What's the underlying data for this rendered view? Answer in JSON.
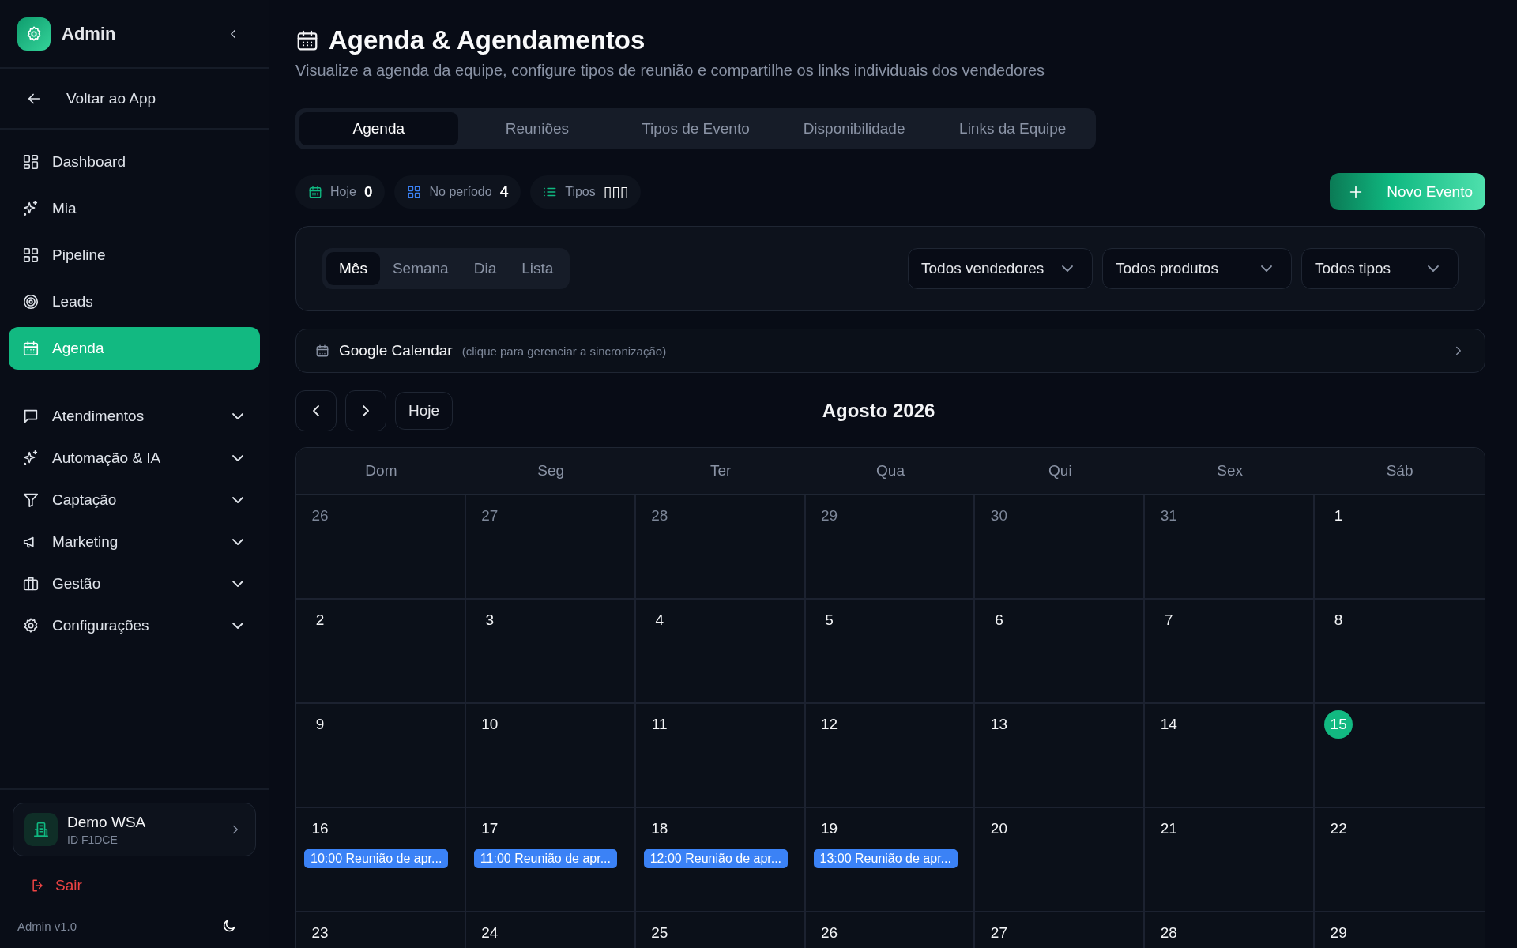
{
  "sidebar": {
    "brand": "Admin",
    "back": "Voltar ao App",
    "items": [
      {
        "label": "Dashboard",
        "selected": false
      },
      {
        "label": "Mia",
        "selected": false
      },
      {
        "label": "Pipeline",
        "selected": false
      },
      {
        "label": "Leads",
        "selected": false
      },
      {
        "label": "Agenda",
        "selected": true
      }
    ],
    "groups": [
      {
        "label": "Atendimentos",
        "expanded": false
      },
      {
        "label": "Automação & IA",
        "expanded": false
      },
      {
        "label": "Captação",
        "expanded": false
      },
      {
        "label": "Marketing",
        "expanded": false
      },
      {
        "label": "Gestão",
        "expanded": false
      },
      {
        "label": "Configurações",
        "expanded": false
      }
    ],
    "workspace": {
      "name": "Demo WSA",
      "id": "ID F1DCE"
    },
    "logout": "Sair",
    "version": "Admin v1.0"
  },
  "header": {
    "title": "Agenda & Agendamentos",
    "subtitle": "Visualize a agenda da equipe, configure tipos de reunião e compartilhe os links individuais dos vendedores"
  },
  "tabs": [
    {
      "label": "Agenda",
      "selected": true
    },
    {
      "label": "Reuniões",
      "selected": false
    },
    {
      "label": "Tipos de Evento",
      "selected": false
    },
    {
      "label": "Disponibilidade",
      "selected": false
    },
    {
      "label": "Links da Equipe",
      "selected": false
    }
  ],
  "stats": [
    {
      "label": "Hoje",
      "value": "0"
    },
    {
      "label": "No período",
      "value": "4"
    },
    {
      "label": "Tipos",
      "value": "▯▯▯"
    }
  ],
  "new_event_button": "Novo Evento",
  "view_modes": [
    {
      "label": "Mês",
      "selected": true
    },
    {
      "label": "Semana",
      "selected": false
    },
    {
      "label": "Dia",
      "selected": false
    },
    {
      "label": "Lista",
      "selected": false
    }
  ],
  "filters": [
    "Todos vendedores",
    "Todos produtos",
    "Todos tipos"
  ],
  "calendar_sync": {
    "title": "Google Calendar",
    "hint": "(clique para gerenciar a sincronização)"
  },
  "calendar": {
    "today_button": "Hoje",
    "month": "Agosto 2026",
    "weekdays": [
      "Dom",
      "Seg",
      "Ter",
      "Qua",
      "Qui",
      "Sex",
      "Sáb"
    ],
    "days": [
      {
        "day": "26",
        "muted": true,
        "today": false
      },
      {
        "day": "27",
        "muted": true,
        "today": false
      },
      {
        "day": "28",
        "muted": true,
        "today": false
      },
      {
        "day": "29",
        "muted": true,
        "today": false
      },
      {
        "day": "30",
        "muted": true,
        "today": false
      },
      {
        "day": "31",
        "muted": true,
        "today": false
      },
      {
        "day": "1",
        "muted": false,
        "today": false
      },
      {
        "day": "2",
        "muted": false,
        "today": false
      },
      {
        "day": "3",
        "muted": false,
        "today": false
      },
      {
        "day": "4",
        "muted": false,
        "today": false
      },
      {
        "day": "5",
        "muted": false,
        "today": false
      },
      {
        "day": "6",
        "muted": false,
        "today": false
      },
      {
        "day": "7",
        "muted": false,
        "today": false
      },
      {
        "day": "8",
        "muted": false,
        "today": false
      },
      {
        "day": "9",
        "muted": false,
        "today": false
      },
      {
        "day": "10",
        "muted": false,
        "today": false
      },
      {
        "day": "11",
        "muted": false,
        "today": false
      },
      {
        "day": "12",
        "muted": false,
        "today": false
      },
      {
        "day": "13",
        "muted": false,
        "today": false
      },
      {
        "day": "14",
        "muted": false,
        "today": false
      },
      {
        "day": "15",
        "muted": false,
        "today": true
      },
      {
        "day": "16",
        "muted": false,
        "today": false,
        "events": [
          "10:00 Reunião de apr..."
        ]
      },
      {
        "day": "17",
        "muted": false,
        "today": false,
        "events": [
          "11:00 Reunião de apr..."
        ]
      },
      {
        "day": "18",
        "muted": false,
        "today": false,
        "events": [
          "12:00 Reunião de apr..."
        ]
      },
      {
        "day": "19",
        "muted": false,
        "today": false,
        "events": [
          "13:00 Reunião de apr..."
        ]
      },
      {
        "day": "20",
        "muted": false,
        "today": false
      },
      {
        "day": "21",
        "muted": false,
        "today": false
      },
      {
        "day": "22",
        "muted": false,
        "today": false
      },
      {
        "day": "23",
        "muted": false,
        "today": false
      },
      {
        "day": "24",
        "muted": false,
        "today": false
      },
      {
        "day": "25",
        "muted": false,
        "today": false
      },
      {
        "day": "26",
        "muted": false,
        "today": false
      },
      {
        "day": "27",
        "muted": false,
        "today": false
      },
      {
        "day": "28",
        "muted": false,
        "today": false
      },
      {
        "day": "29",
        "muted": false,
        "today": false
      }
    ]
  }
}
